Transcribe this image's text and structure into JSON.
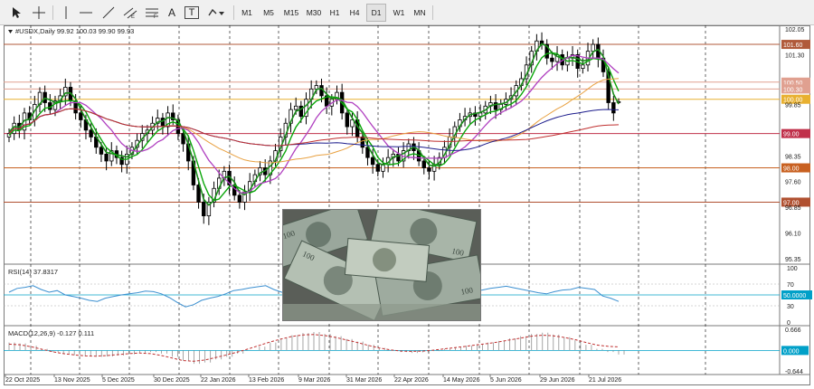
{
  "toolbar": {
    "tools": [
      {
        "name": "cursor-arrow-icon"
      },
      {
        "name": "crosshair-icon"
      },
      {
        "name": "vertical-line-icon"
      },
      {
        "name": "horizontal-line-icon"
      },
      {
        "name": "trendline-icon"
      },
      {
        "name": "equidistant-channel-icon"
      },
      {
        "name": "fibonacci-icon"
      },
      {
        "name": "text-tool-icon"
      },
      {
        "name": "text-label-icon"
      },
      {
        "name": "shapes-menu-icon"
      }
    ],
    "text_tool_label": "A",
    "label_tool_label": "T",
    "timeframes": [
      "M1",
      "M5",
      "M15",
      "M30",
      "H1",
      "H4",
      "D1",
      "W1",
      "MN"
    ],
    "active_timeframe": "D1"
  },
  "chart": {
    "header": "#USDX,Daily  99.92 100.03 99.90 99.93",
    "price_axis": [
      "102.05",
      "101.30",
      "99.85",
      "98.35",
      "97.60",
      "96.85",
      "96.10",
      "95.35"
    ],
    "level_lines": [
      {
        "price": 101.6,
        "label": "101.60",
        "color": "#b05a3a"
      },
      {
        "price": 100.5,
        "label": "100.50",
        "color": "#e0a090"
      },
      {
        "price": 100.3,
        "label": "100.30",
        "color": "#e0a090"
      },
      {
        "price": 100.0,
        "label": "100.00",
        "color": "#e8b030"
      },
      {
        "price": 99.0,
        "label": "99.00",
        "color": "#c0304a"
      },
      {
        "price": 98.0,
        "label": "98.00",
        "color": "#c86020"
      },
      {
        "price": 97.0,
        "label": "97.00",
        "color": "#b05030"
      }
    ],
    "date_axis": [
      "22 Oct 2025",
      "13 Nov 2025",
      "5 Dec 2025",
      "30 Dec 2025",
      "22 Jan 2026",
      "13 Feb 2026",
      "9 Mar 2026",
      "31 Mar 2026",
      "22 Apr 2026",
      "14 May 2026",
      "5 Jun 2026",
      "29 Jun 2026",
      "21 Jul 2026"
    ],
    "colors": {
      "candles": "#000000",
      "ema_fast": "#1a8c1a",
      "ema_mid": "#0aa60a",
      "ma_violet": "#b040c0",
      "ma_orange": "#e8a040",
      "ma_navy": "#1c1c8c",
      "ma_red": "#c03030",
      "rsi_line": "#3b8fd0",
      "macd_hist": "#909090",
      "macd_signal": "#c03030",
      "level_bg": "#00a0c8"
    }
  },
  "rsi": {
    "label": "RSI(14) 37.8317",
    "axis": [
      "100",
      "70",
      "50.0000",
      "30",
      "0"
    ],
    "level_50": "50.0000"
  },
  "macd": {
    "label": "MACD(12,26,9) -0.127 0.111",
    "axis": [
      "0.666",
      "0.000",
      "-0.644"
    ],
    "zero_label": "0.000"
  },
  "chart_data": {
    "type": "candlestick",
    "symbol": "#USDX",
    "timeframe": "Daily",
    "last_bar": {
      "open": 99.92,
      "high": 100.03,
      "low": 99.9,
      "close": 99.93
    },
    "closes": [
      99.0,
      99.3,
      99.1,
      99.6,
      99.4,
      99.85,
      100.2,
      99.9,
      99.7,
      99.95,
      100.1,
      100.35,
      99.95,
      99.6,
      99.4,
      99.1,
      98.9,
      98.6,
      98.4,
      98.2,
      98.5,
      98.3,
      98.1,
      98.4,
      98.6,
      98.8,
      99.0,
      99.1,
      99.3,
      99.45,
      99.2,
      99.6,
      99.4,
      99.0,
      98.7,
      98.2,
      97.5,
      97.0,
      96.6,
      97.0,
      97.4,
      97.7,
      97.9,
      97.5,
      97.2,
      97.0,
      97.3,
      97.6,
      97.8,
      98.0,
      97.8,
      98.2,
      98.5,
      98.9,
      99.3,
      99.7,
      99.8,
      99.5,
      100.0,
      100.3,
      100.4,
      100.1,
      99.8,
      100.0,
      100.2,
      99.6,
      99.2,
      99.4,
      98.9,
      98.6,
      98.3,
      98.1,
      97.9,
      98.1,
      98.3,
      98.4,
      98.2,
      98.5,
      98.7,
      98.5,
      98.2,
      98.0,
      97.9,
      98.1,
      98.3,
      98.6,
      98.9,
      99.2,
      99.4,
      99.5,
      99.6,
      99.5,
      99.6,
      99.8,
      99.9,
      99.7,
      99.85,
      100.0,
      100.1,
      100.4,
      100.6,
      101.0,
      101.4,
      101.7,
      101.6,
      101.2,
      101.1,
      101.3,
      101.0,
      101.2,
      101.3,
      100.9,
      101.0,
      101.4,
      101.6,
      101.2,
      100.8,
      99.9,
      99.6,
      99.93
    ],
    "rsi": [
      55,
      62,
      64,
      67,
      60,
      55,
      58,
      50,
      47,
      44,
      40,
      38,
      44,
      47,
      50,
      52,
      54,
      57,
      56,
      52,
      45,
      36,
      28,
      32,
      40,
      44,
      47,
      52,
      58,
      60,
      63,
      65,
      67,
      60,
      55,
      52,
      50,
      48,
      50,
      46,
      42,
      47,
      52,
      56,
      55,
      57,
      60,
      63,
      65,
      68,
      67,
      64,
      60,
      56,
      57,
      55,
      53,
      51,
      57,
      59,
      62,
      64,
      66,
      63,
      60,
      57,
      54,
      52,
      56,
      59,
      60,
      64,
      62,
      60,
      48,
      44,
      38
    ],
    "macd_hist": [
      0.25,
      0.22,
      0.15,
      0.05,
      -0.05,
      -0.12,
      -0.15,
      -0.18,
      -0.2,
      -0.19,
      -0.16,
      -0.12,
      -0.08,
      -0.05,
      -0.1,
      -0.2,
      -0.32,
      -0.42,
      -0.38,
      -0.28,
      -0.2,
      -0.1,
      0.0,
      0.12,
      0.25,
      0.38,
      0.48,
      0.55,
      0.58,
      0.52,
      0.45,
      0.36,
      0.28,
      0.18,
      0.08,
      0.0,
      -0.05,
      -0.08,
      -0.06,
      -0.02,
      0.05,
      0.1,
      0.15,
      0.2,
      0.25,
      0.3,
      0.38,
      0.45,
      0.52,
      0.56,
      0.5,
      0.42,
      0.32,
      0.18,
      0.05,
      -0.05,
      -0.127
    ],
    "macd_signal": [
      0.2,
      0.18,
      0.12,
      0.04,
      -0.04,
      -0.1,
      -0.14,
      -0.17,
      -0.18,
      -0.16,
      -0.13,
      -0.1,
      -0.08,
      -0.1,
      -0.16,
      -0.24,
      -0.32,
      -0.34,
      -0.3,
      -0.22,
      -0.14,
      -0.05,
      0.05,
      0.16,
      0.27,
      0.36,
      0.44,
      0.49,
      0.5,
      0.47,
      0.41,
      0.33,
      0.25,
      0.16,
      0.08,
      0.02,
      -0.02,
      -0.03,
      -0.02,
      0.01,
      0.05,
      0.09,
      0.13,
      0.18,
      0.22,
      0.27,
      0.33,
      0.39,
      0.45,
      0.48,
      0.46,
      0.41,
      0.34,
      0.25,
      0.17,
      0.13,
      0.111
    ],
    "price_axis_range": [
      95.35,
      102.05
    ],
    "rsi_range": [
      0,
      100
    ],
    "macd_range": [
      -0.644,
      0.666
    ]
  }
}
